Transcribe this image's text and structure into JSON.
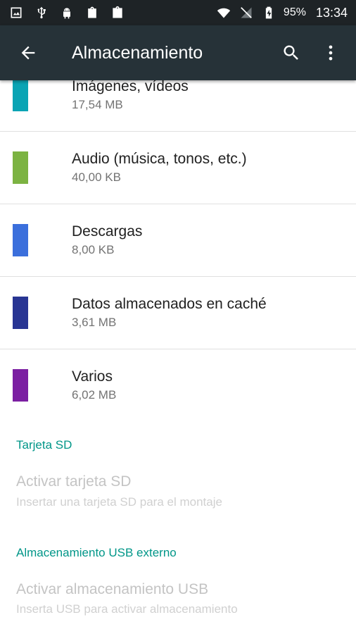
{
  "status_bar": {
    "left_icons": [
      "image-icon",
      "usb-icon",
      "android-icon",
      "clipboard-icon",
      "clipboard-check-icon"
    ],
    "right_icons": [
      "wifi-icon",
      "no-signal-icon",
      "battery-charging-icon"
    ],
    "battery": "95%",
    "time": "13:34"
  },
  "app_bar": {
    "title": "Almacenamiento",
    "back_icon": "arrow-back-icon",
    "search_icon": "search-icon",
    "menu_icon": "more-vert-icon"
  },
  "storage_items": [
    {
      "title": "Imágenes, vídeos",
      "size": "17,54 MB",
      "color": "#0aa4b4"
    },
    {
      "title": "Audio (música, tonos, etc.)",
      "size": "40,00 KB",
      "color": "#7cb342"
    },
    {
      "title": "Descargas",
      "size": "8,00 KB",
      "color": "#3b6fdc"
    },
    {
      "title": "Datos almacenados en caché",
      "size": "3,61 MB",
      "color": "#283593"
    },
    {
      "title": "Varios",
      "size": "6,02 MB",
      "color": "#7b1fa2"
    }
  ],
  "sd_section": {
    "header": "Tarjeta SD",
    "title": "Activar tarjeta SD",
    "summary": "Insertar una tarjeta SD para el montaje"
  },
  "usb_section": {
    "header": "Almacenamiento USB externo",
    "title": "Activar almacenamiento USB",
    "summary": "Inserta USB para activar almacenamiento"
  },
  "colors": {
    "status_bar": "#1e2326",
    "app_bar": "#263238",
    "accent": "#009688",
    "disabled_text": "#c4c4c4"
  }
}
